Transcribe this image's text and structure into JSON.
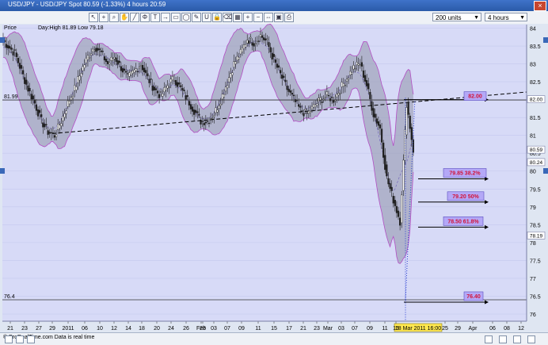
{
  "window": {
    "title": "USD/JPY - USD/JPY Spot    80.59 (-1.33%)    4 hours   20:59",
    "close_icon": "close-icon"
  },
  "toolbar": {
    "icons": [
      "cursor-icon",
      "crosshair-icon",
      "zoom-icon",
      "hand-icon",
      "line-icon",
      "fibonacci-icon",
      "text-icon",
      "arrow-icon",
      "rectangle-icon",
      "ellipse-icon",
      "pen-icon",
      "magnet-icon",
      "lock-icon",
      "eraser-icon",
      "grid-icon",
      "plus-icon",
      "minus-icon",
      "fit-icon",
      "camera-icon",
      "print-icon"
    ],
    "units_value": "200 units",
    "timeframe_value": "4 hours"
  },
  "legend": {
    "price_label": "Price",
    "day_range": "Day:High 81.89 Low 79.18"
  },
  "footer": {
    "source_text": "© ProRealTime.com Data is real time"
  },
  "colors": {
    "plot_bg": "#d7daf7",
    "candle": "#1f1f1f",
    "band_fill": "#8f93aa",
    "band_line": "#b24ec4",
    "fib_box": "#b4a8f7",
    "fib_text": "#d2143a"
  },
  "chart_data": {
    "type": "candlestick",
    "ylim": [
      75.8,
      84.1
    ],
    "y_ticks": [
      84,
      83.5,
      83,
      82.5,
      82,
      81.5,
      81,
      80.5,
      80,
      79.5,
      79,
      78.5,
      78,
      77.5,
      77,
      76.5,
      76
    ],
    "y_tick_labels": [
      "84",
      "83.5",
      "83",
      "82.5",
      "82",
      "81.5",
      "81",
      "80.5",
      "80",
      "79.5",
      "79",
      "78.5",
      "78",
      "77.5",
      "77",
      "76.5",
      "76"
    ],
    "x_ticks": [
      {
        "label": "21",
        "x": 13
      },
      {
        "label": "23",
        "x": 31
      },
      {
        "label": "27",
        "x": 49
      },
      {
        "label": "29",
        "x": 66
      },
      {
        "label": "2011",
        "x": 86
      },
      {
        "label": "06",
        "x": 107
      },
      {
        "label": "10",
        "x": 126
      },
      {
        "label": "12",
        "x": 144
      },
      {
        "label": "14",
        "x": 162
      },
      {
        "label": "18",
        "x": 179
      },
      {
        "label": "20",
        "x": 198
      },
      {
        "label": "24",
        "x": 216
      },
      {
        "label": "26",
        "x": 235
      },
      {
        "label": "28",
        "x": 256
      },
      {
        "label": "Feb",
        "x": 254
      },
      {
        "label": "03",
        "x": 270
      },
      {
        "label": "07",
        "x": 287
      },
      {
        "label": "09",
        "x": 305
      },
      {
        "label": "11",
        "x": 326
      },
      {
        "label": "15",
        "x": 346
      },
      {
        "label": "17",
        "x": 365
      },
      {
        "label": "21",
        "x": 383
      },
      {
        "label": "23",
        "x": 400
      },
      {
        "label": "Mar",
        "x": 414
      },
      {
        "label": "03",
        "x": 431
      },
      {
        "label": "07",
        "x": 448
      },
      {
        "label": "09",
        "x": 467
      },
      {
        "label": "11",
        "x": 486
      },
      {
        "label": "15",
        "x": 500
      },
      {
        "label": "25",
        "x": 562
      },
      {
        "label": "29",
        "x": 578
      },
      {
        "label": "Apr",
        "x": 597
      },
      {
        "label": "06",
        "x": 622
      },
      {
        "label": "08",
        "x": 640
      },
      {
        "label": "12",
        "x": 658
      }
    ],
    "series_close": [
      83.7,
      83.5,
      83.3,
      82.8,
      82.3,
      81.9,
      81.4,
      81.1,
      81.0,
      81.4,
      81.9,
      82.3,
      82.8,
      83.2,
      83.5,
      83.3,
      83.0,
      83.2,
      82.9,
      82.6,
      82.8,
      83.0,
      82.6,
      82.3,
      82.1,
      82.4,
      82.6,
      82.3,
      82.0,
      81.7,
      81.4,
      81.4,
      81.6,
      82.0,
      82.5,
      83.0,
      83.3,
      83.7,
      83.6,
      83.8,
      83.6,
      83.1,
      82.7,
      82.3,
      82.0,
      81.7,
      81.6,
      81.8,
      82.0,
      82.1,
      82.0,
      82.3,
      82.6,
      82.9,
      83.0,
      82.4,
      81.6,
      81.2,
      79.8,
      79.2,
      78.6,
      81.9,
      80.59
    ],
    "date_label": "18 Mar 2011 16:00",
    "annotations": {
      "support_trendline": {
        "from_x": "29",
        "from_y": 81.05,
        "to_x": "12",
        "to_y": 82.2
      },
      "horizontal_lines": [
        {
          "value": 81.99,
          "label": "81.99"
        },
        {
          "value": 76.4,
          "label": "76.4"
        }
      ],
      "fib_levels": [
        {
          "text": "82.00",
          "value": 82.0
        },
        {
          "text": "79.85  38.2%",
          "value": 79.85
        },
        {
          "text": "79.20  50%",
          "value": 79.2
        },
        {
          "text": "78.50  61.8%",
          "value": 78.5
        },
        {
          "text": "76.40",
          "value": 76.4
        }
      ],
      "right_axis_tags": [
        {
          "label": "82.00",
          "value": 82.0
        },
        {
          "label": "80.59",
          "value": 80.59
        },
        {
          "label": "80.24",
          "value": 80.24
        },
        {
          "label": "78.19",
          "value": 78.19
        }
      ]
    }
  }
}
